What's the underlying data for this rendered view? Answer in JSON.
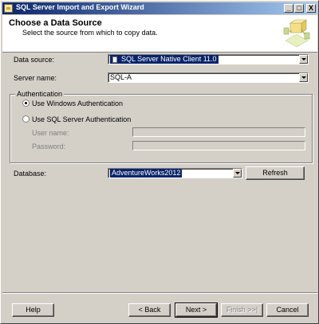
{
  "window": {
    "title": "SQL Server Import and Export Wizard",
    "controls": [
      "_",
      "□",
      "X"
    ]
  },
  "header": {
    "title": "Choose a Data Source",
    "subtitle": "Select the source from which to copy data."
  },
  "form": {
    "data_source_label": "Data source:",
    "data_source_value": "SQL Server Native Client 11.0",
    "server_name_label": "Server name:",
    "server_name_value": "SQL-A",
    "auth_group_label": "Authentication",
    "auth_windows_label": "Use Windows Authentication",
    "auth_sql_label": "Use SQL Server Authentication",
    "auth_selected": "windows",
    "username_label": "User name:",
    "password_label": "Password:",
    "database_label": "Database:",
    "database_value": "AdventureWorks2012",
    "refresh_label": "Refresh"
  },
  "footer": {
    "help": "Help",
    "back": "< Back",
    "next": "Next >",
    "finish": "Finish >>|",
    "cancel": "Cancel"
  },
  "icons": {
    "app": "wizard-app-icon",
    "header": "data-source-icon"
  }
}
